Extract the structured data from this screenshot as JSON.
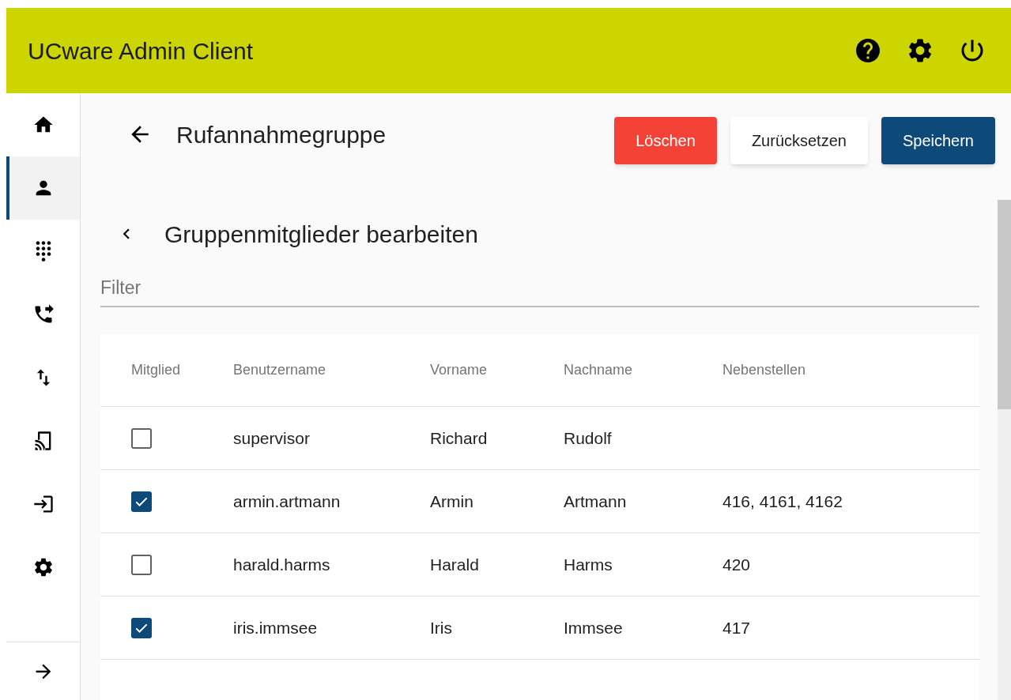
{
  "app_bar": {
    "title": "UCware Admin Client"
  },
  "sidebar": {
    "items": [
      {
        "selected": false
      },
      {
        "selected": true
      },
      {
        "selected": false
      },
      {
        "selected": false
      },
      {
        "selected": false
      },
      {
        "selected": false
      },
      {
        "selected": false
      },
      {
        "selected": false
      }
    ]
  },
  "page": {
    "title": "Rufannahmegruppe",
    "buttons": [
      {
        "label": "Löschen",
        "kind": "danger"
      },
      {
        "label": "Zurücksetzen",
        "kind": "plain"
      },
      {
        "label": "Speichern",
        "kind": "primary"
      }
    ]
  },
  "section": {
    "title": "Gruppenmitglieder bearbeiten",
    "filter": {
      "placeholder": "Filter"
    }
  },
  "table": {
    "columns": [
      "Mitglied",
      "Benutzername",
      "Vorname",
      "Nachname",
      "Nebenstellen"
    ],
    "rows": [
      {
        "checked": false,
        "cells": [
          "",
          "supervisor",
          "Richard",
          "Rudolf",
          ""
        ]
      },
      {
        "checked": true,
        "cells": [
          "",
          "armin.artmann",
          "Armin",
          "Artmann",
          "416, 4161, 4162"
        ]
      },
      {
        "checked": false,
        "cells": [
          "",
          "harald.harms",
          "Harald",
          "Harms",
          "420"
        ]
      },
      {
        "checked": true,
        "cells": [
          "",
          "iris.immsee",
          "Iris",
          "Immsee",
          "417"
        ]
      }
    ]
  }
}
